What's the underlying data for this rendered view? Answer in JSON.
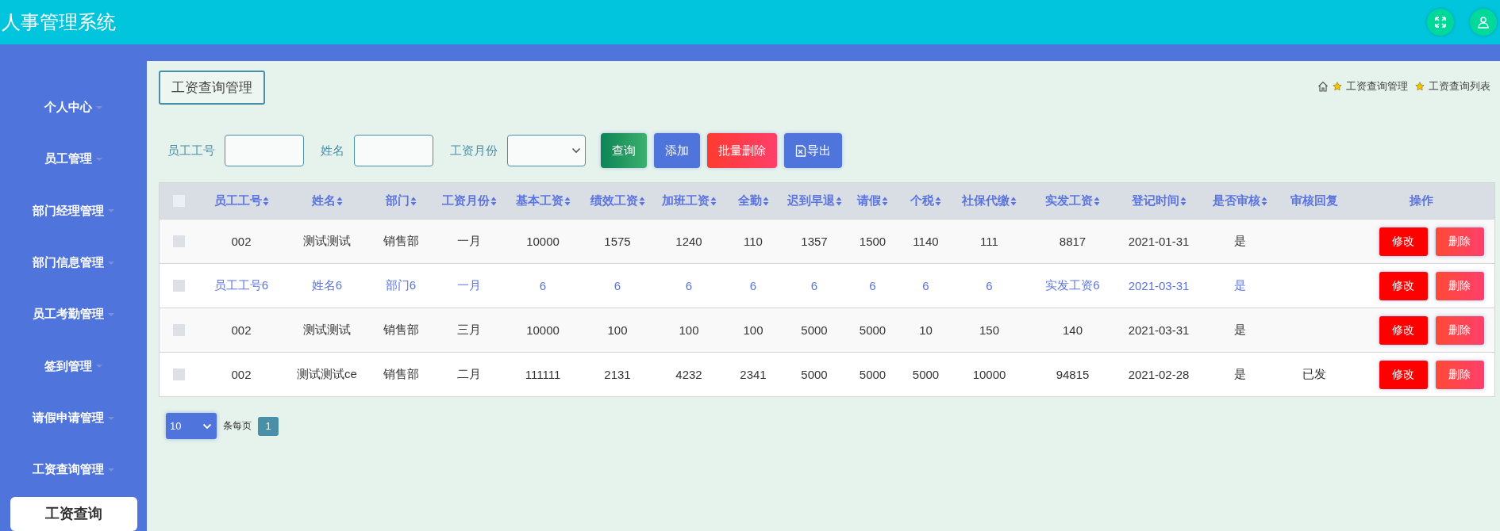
{
  "header": {
    "title": "人事管理系统"
  },
  "sidebar": {
    "items": [
      {
        "label": "个人中心"
      },
      {
        "label": "员工管理"
      },
      {
        "label": "部门经理管理"
      },
      {
        "label": "部门信息管理"
      },
      {
        "label": "员工考勤管理"
      },
      {
        "label": "签到管理"
      },
      {
        "label": "请假申请管理"
      },
      {
        "label": "工资查询管理",
        "children": [
          {
            "label": "工资查询",
            "selected": true
          }
        ]
      }
    ]
  },
  "page_title": "工资查询管理",
  "breadcrumb": [
    {
      "label": "工资查询管理"
    },
    {
      "label": "工资查询列表"
    }
  ],
  "search": {
    "fields": [
      {
        "label": "员工工号",
        "kind": "text"
      },
      {
        "label": "姓名",
        "kind": "text"
      },
      {
        "label": "工资月份",
        "kind": "select"
      }
    ],
    "buttons": [
      {
        "label": "查询",
        "kind": "search"
      },
      {
        "label": "添加",
        "kind": "add"
      },
      {
        "label": "批量删除",
        "kind": "delete"
      },
      {
        "label": "导出",
        "kind": "export"
      }
    ]
  },
  "table": {
    "select_all": false,
    "columns": [
      {
        "label": "员工工号",
        "sortable": true
      },
      {
        "label": "姓名",
        "sortable": true
      },
      {
        "label": "部门",
        "sortable": true
      },
      {
        "label": "工资月份",
        "sortable": true
      },
      {
        "label": "基本工资",
        "sortable": true
      },
      {
        "label": "绩效工资",
        "sortable": true
      },
      {
        "label": "加班工资",
        "sortable": true
      },
      {
        "label": "全勤",
        "sortable": true
      },
      {
        "label": "迟到早退",
        "sortable": true
      },
      {
        "label": "请假",
        "sortable": true
      },
      {
        "label": "个税",
        "sortable": true
      },
      {
        "label": "社保代缴",
        "sortable": true
      },
      {
        "label": "实发工资",
        "sortable": true
      },
      {
        "label": "登记时间",
        "sortable": true
      },
      {
        "label": "是否审核",
        "sortable": true
      },
      {
        "label": "审核回复",
        "sortable": false
      },
      {
        "label": "操作",
        "sortable": false
      }
    ],
    "rows": [
      {
        "checked": false,
        "highlighted": false,
        "cells": [
          "002",
          "测试测试",
          "销售部",
          "一月",
          "10000",
          "1575",
          "1240",
          "110",
          "1357",
          "1500",
          "1140",
          "111",
          "8817",
          "2021-01-31",
          "是",
          ""
        ],
        "actions": [
          {
            "label": "修改",
            "kind": "edit"
          },
          {
            "label": "删除",
            "kind": "delete"
          }
        ]
      },
      {
        "checked": false,
        "highlighted": true,
        "cells": [
          "员工工号6",
          "姓名6",
          "部门6",
          "一月",
          "6",
          "6",
          "6",
          "6",
          "6",
          "6",
          "6",
          "6",
          "实发工资6",
          "2021-03-31",
          "是",
          ""
        ],
        "actions": [
          {
            "label": "修改",
            "kind": "edit"
          },
          {
            "label": "删除",
            "kind": "delete"
          }
        ]
      },
      {
        "checked": false,
        "highlighted": false,
        "cells": [
          "002",
          "测试测试",
          "销售部",
          "三月",
          "10000",
          "100",
          "100",
          "100",
          "5000",
          "5000",
          "10",
          "150",
          "140",
          "2021-03-31",
          "是",
          ""
        ],
        "actions": [
          {
            "label": "修改",
            "kind": "edit"
          },
          {
            "label": "删除",
            "kind": "delete"
          }
        ]
      },
      {
        "checked": false,
        "highlighted": false,
        "cells": [
          "002",
          "测试测试ce",
          "销售部",
          "二月",
          "111111",
          "2131",
          "4232",
          "2341",
          "5000",
          "5000",
          "5000",
          "10000",
          "94815",
          "2021-02-28",
          "是",
          "已发"
        ],
        "actions": [
          {
            "label": "修改",
            "kind": "edit"
          },
          {
            "label": "删除",
            "kind": "delete"
          }
        ]
      }
    ]
  },
  "pagination": {
    "page_size": "10",
    "per_page_label": "条每页",
    "pages": [
      {
        "label": "1",
        "selected": true
      }
    ]
  }
}
